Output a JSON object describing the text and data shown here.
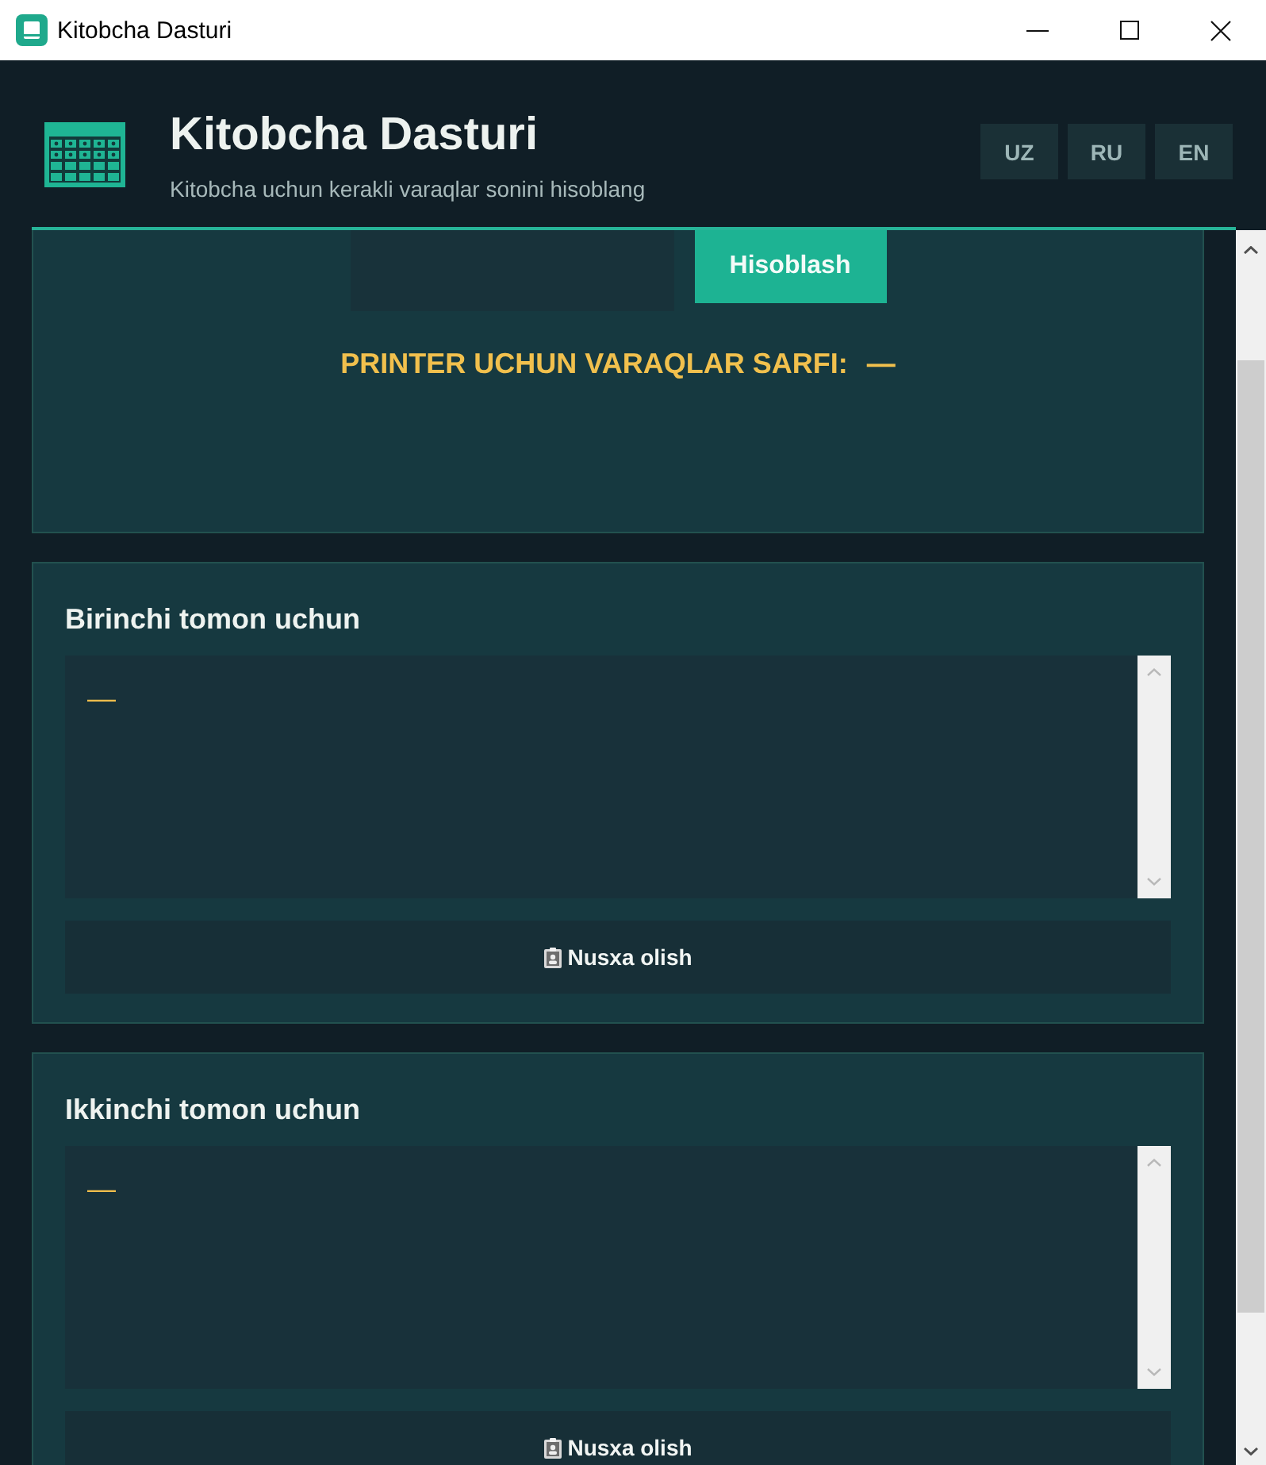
{
  "window": {
    "title": "Kitobcha Dasturi"
  },
  "header": {
    "title": "Kitobcha Dasturi",
    "subtitle": "Kitobcha uchun kerakli varaqlar sonini hisoblang",
    "languages": [
      {
        "label": "UZ",
        "selected": false
      },
      {
        "label": "RU",
        "selected": false
      },
      {
        "label": "EN",
        "selected": false
      }
    ]
  },
  "calculator": {
    "button": "Hisoblash",
    "result_label": "PRINTER UCHUN VARAQLAR SARFI:",
    "result_value": "—"
  },
  "sides": [
    {
      "title": "Birinchi tomon uchun",
      "output": "—",
      "copy_button": "Nusxa olish"
    },
    {
      "title": "Ikkinchi tomon uchun",
      "output": "—",
      "copy_button": "Nusxa olish"
    }
  ]
}
